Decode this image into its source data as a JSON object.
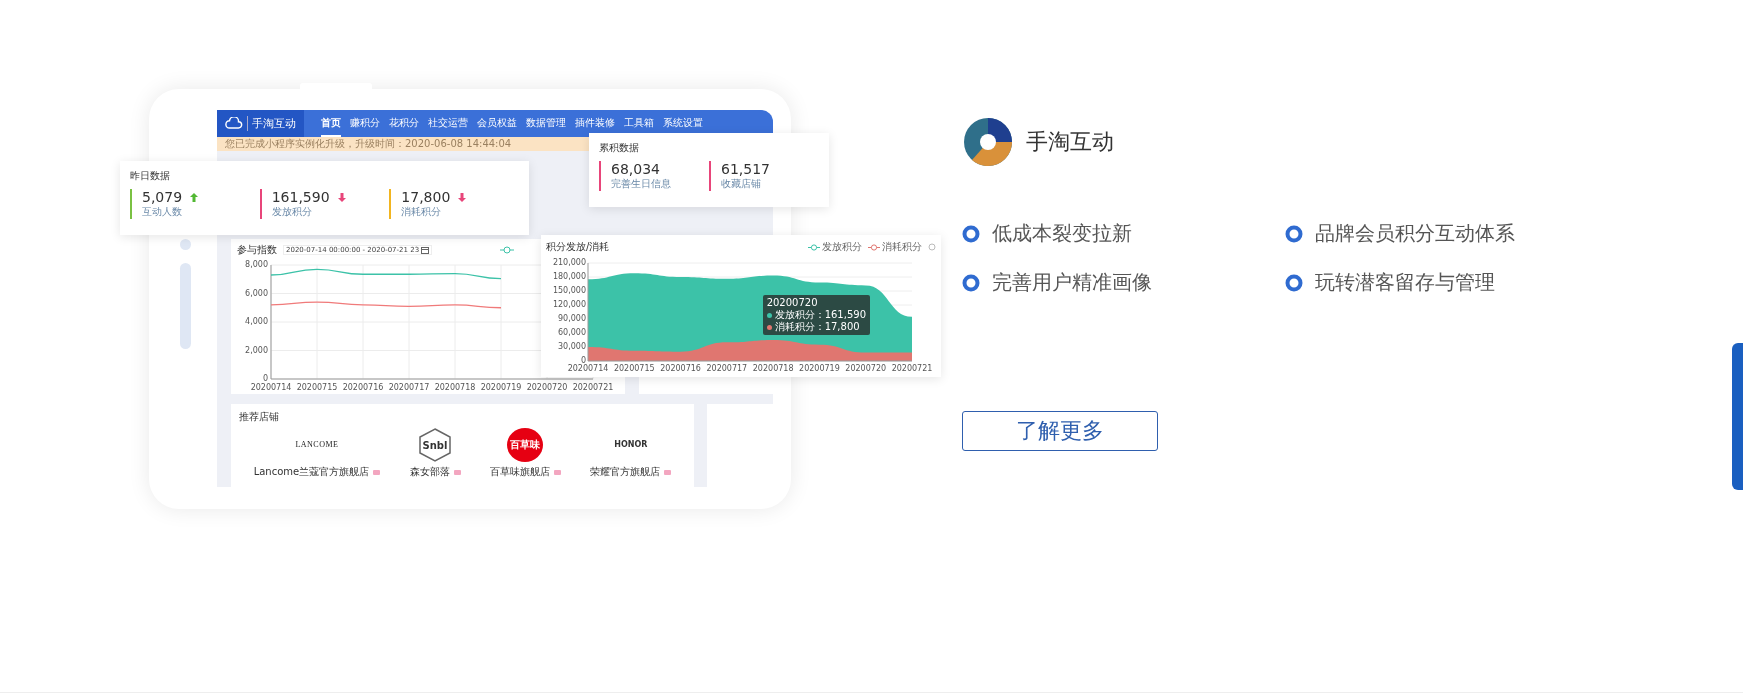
{
  "dashboard": {
    "nav": {
      "brand": "手淘互动",
      "items": [
        {
          "label": "首页",
          "selected": true
        },
        {
          "label": "赚积分",
          "selected": false
        },
        {
          "label": "花积分",
          "selected": false
        },
        {
          "label": "社交运营",
          "selected": false
        },
        {
          "label": "会员权益",
          "selected": false
        },
        {
          "label": "数据管理",
          "selected": false
        },
        {
          "label": "插件装修",
          "selected": false
        },
        {
          "label": "工具箱",
          "selected": false
        },
        {
          "label": "系统设置",
          "selected": false
        }
      ]
    },
    "notice": "您已完成小程序实例化升级，升级时间：2020-06-08 14:44:04",
    "yesterday": {
      "title": "昨日数据",
      "metrics": [
        {
          "value": "5,079",
          "label": "互动人数",
          "rising": true,
          "color": "#7ac143"
        },
        {
          "value": "161,590",
          "label": "发放积分",
          "rising": false,
          "color": "#e8457a"
        },
        {
          "value": "17,800",
          "label": "消耗积分",
          "rising": false,
          "color": "#f2b520"
        }
      ]
    },
    "cumulative": {
      "title": "累积数据",
      "metrics": [
        {
          "value": "68,034",
          "label": "完善生日信息",
          "color": "#e8457a"
        },
        {
          "value": "61,517",
          "label": "收藏店铺",
          "color": "#e8457a"
        }
      ]
    },
    "participation": {
      "title": "参与指数",
      "date_range": "2020-07-14 00:00:00 - 2020-07-21 23",
      "chart_data": {
        "type": "line",
        "grid": true,
        "categories": [
          "20200714",
          "20200715",
          "20200716",
          "20200717",
          "20200718",
          "20200719",
          "20200720",
          "20200721"
        ],
        "ylim": [
          0,
          8000
        ],
        "yticks": [
          0,
          {
            "value": 2000,
            "label": "2,000"
          },
          {
            "value": 4000,
            "label": "4,000"
          },
          {
            "value": 6000,
            "label": "6,000"
          },
          {
            "value": 8000,
            "label": "8,000"
          }
        ],
        "series": [
          {
            "color": "#3cc2a8",
            "values": [
              7300,
              7700,
              7350,
              7350,
              7400,
              7050,
              null,
              null
            ]
          },
          {
            "color": "#f07a7a",
            "values": [
              5200,
              5400,
              5200,
              5100,
              5200,
              5000,
              null,
              null
            ]
          }
        ]
      }
    },
    "points": {
      "title": "积分发放/消耗",
      "chart_data": {
        "type": "area",
        "grid": true,
        "categories": [
          "20200714",
          "20200715",
          "20200716",
          "20200717",
          "20200718",
          "20200719",
          "20200720",
          "20200721"
        ],
        "ylim": [
          0,
          210000
        ],
        "yticks": [
          0,
          {
            "value": 30000,
            "label": "30,000"
          },
          {
            "value": 60000,
            "label": "60,000"
          },
          {
            "value": 90000,
            "label": "90,000"
          },
          {
            "value": 120000,
            "label": "120,000"
          },
          {
            "value": 150000,
            "label": "150,000"
          },
          {
            "value": 180000,
            "label": "180,000"
          },
          {
            "value": 210000,
            "label": "210,000"
          }
        ],
        "series": [
          {
            "name": "发放积分",
            "color": "#3cc2a8",
            "values": [
              175000,
              188000,
              180000,
              176000,
              183000,
              168000,
              162000,
              95000
            ]
          },
          {
            "name": "消耗积分",
            "color": "#e07670",
            "values": [
              30000,
              22000,
              20000,
              40000,
              45000,
              35000,
              18000,
              18000
            ]
          }
        ]
      },
      "tooltip": {
        "title": "20200720",
        "lines": [
          {
            "text": "发放积分：161,590",
            "color": "#3cc2a8"
          },
          {
            "text": "消耗积分：17,800",
            "color": "#e07670"
          }
        ]
      }
    },
    "stores": {
      "title": "推荐店铺",
      "items": [
        {
          "kind": "wordmark",
          "logo_text": "LANCOME",
          "name": "Lancome兰蔻官方旗舰店"
        },
        {
          "kind": "hexagon",
          "logo_text": "Snbl",
          "name": "森女部落"
        },
        {
          "kind": "circle",
          "logo_text": "百草味",
          "name": "百草味旗舰店"
        },
        {
          "kind": "bold",
          "logo_text": "HONOR",
          "name": "荣耀官方旗舰店"
        }
      ]
    }
  },
  "product": {
    "name": "手淘互动",
    "features": [
      "低成本裂变拉新",
      "品牌会员积分互动体系",
      "完善用户精准画像",
      "玩转潜客留存与管理"
    ],
    "cta": "了解更多"
  }
}
